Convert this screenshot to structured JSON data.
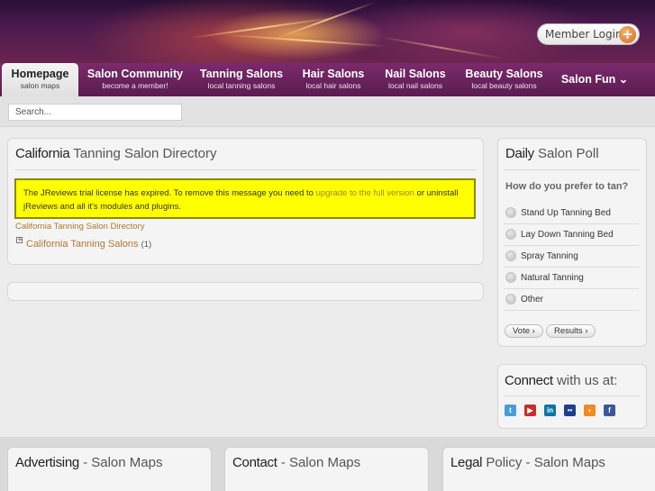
{
  "header": {
    "member_login_label": "Member Login",
    "member_login_icon": "plus-icon"
  },
  "nav": {
    "items": [
      {
        "title": "Homepage",
        "sub": "salon maps"
      },
      {
        "title": "Salon Community",
        "sub": "become a member!"
      },
      {
        "title": "Tanning Salons",
        "sub": "local tanning salons"
      },
      {
        "title": "Hair Salons",
        "sub": "local hair salons"
      },
      {
        "title": "Nail Salons",
        "sub": "local nail salons"
      },
      {
        "title": "Beauty Salons",
        "sub": "local beauty salons"
      },
      {
        "title": "Salon Fun ⌄",
        "sub": ""
      }
    ]
  },
  "search": {
    "placeholder": "Search..."
  },
  "main": {
    "title_bold": "California",
    "title_rest": " Tanning Salon Directory",
    "notice_before": "The JReviews trial license has expired. To remove this message you need to ",
    "notice_link": "upgrade to the full version",
    "notice_after": " or uninstall jReviews and all it's modules and plugins.",
    "breadcrumb": "California Tanning Salon Directory",
    "tree_link": "California Tanning Salons",
    "tree_count": "(1)",
    "expander_symbol": "+"
  },
  "poll": {
    "title_bold": "Daily",
    "title_rest": " Salon Poll",
    "question": "How do you prefer to tan?",
    "options": [
      "Stand Up Tanning Bed",
      "Lay Down Tanning Bed",
      "Spray Tanning",
      "Natural Tanning",
      "Other"
    ],
    "vote_label": "Vote ›",
    "results_label": "Results ›"
  },
  "connect": {
    "title_bold": "Connect",
    "title_rest": " with us at:",
    "icons": [
      {
        "name": "twitter-icon",
        "color": "#4a9ed6",
        "glyph": "t"
      },
      {
        "name": "youtube-icon",
        "color": "#c4302b",
        "glyph": "▶"
      },
      {
        "name": "linkedin-icon",
        "color": "#0e76a8",
        "glyph": "in"
      },
      {
        "name": "flickr-icon",
        "color": "#1d3f8f",
        "glyph": "••"
      },
      {
        "name": "rss-icon",
        "color": "#f08a24",
        "glyph": "◗"
      },
      {
        "name": "facebook-icon",
        "color": "#3b5998",
        "glyph": "f"
      }
    ]
  },
  "footer": {
    "boxes": [
      {
        "title_bold": "Advertising",
        "title_rest": " - Salon Maps"
      },
      {
        "title_bold": "Contact",
        "title_rest": " - Salon Maps"
      },
      {
        "title_bold": "Legal",
        "title_rest": " Policy - Salon Maps"
      }
    ]
  }
}
